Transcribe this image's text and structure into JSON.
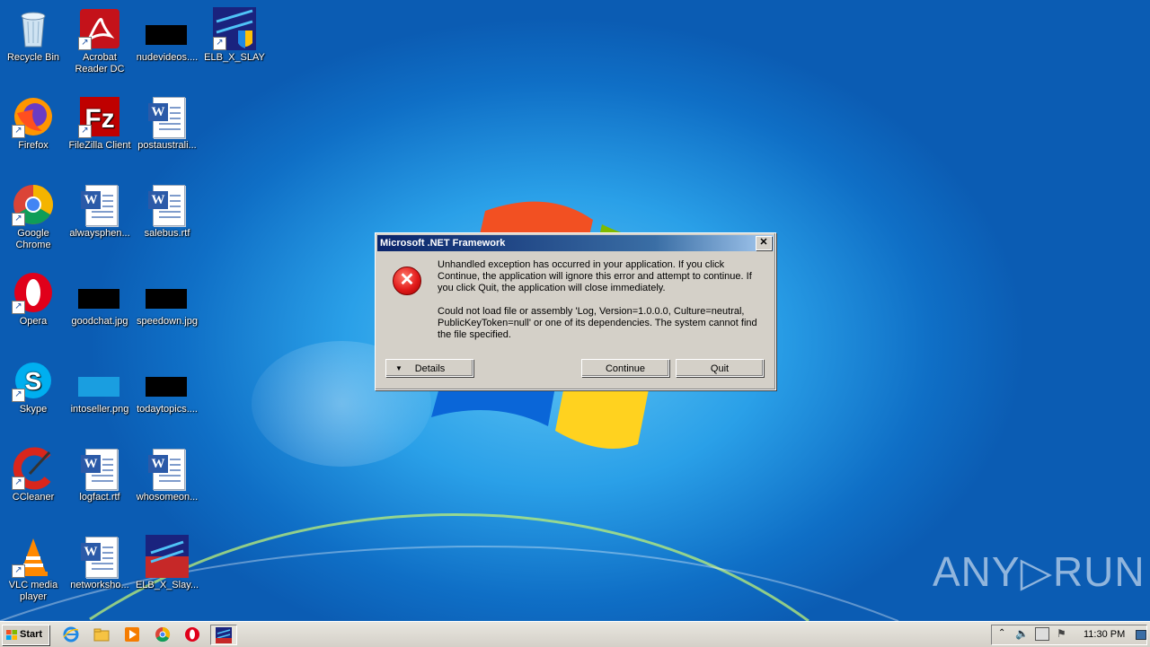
{
  "desktop": {
    "icons": [
      {
        "label": "Recycle Bin"
      },
      {
        "label": "Acrobat Reader DC"
      },
      {
        "label": "nudevideos...."
      },
      {
        "label": "ELB_X_SLAY"
      },
      {
        "label": "Firefox"
      },
      {
        "label": "FileZilla Client"
      },
      {
        "label": "postaustrali..."
      },
      {
        "label": "Google Chrome"
      },
      {
        "label": "alwaysphen..."
      },
      {
        "label": "salebus.rtf"
      },
      {
        "label": "Opera"
      },
      {
        "label": "goodchat.jpg"
      },
      {
        "label": "speedown.jpg"
      },
      {
        "label": "Skype"
      },
      {
        "label": "intoseller.png"
      },
      {
        "label": "todaytopics...."
      },
      {
        "label": "CCleaner"
      },
      {
        "label": "logfact.rtf"
      },
      {
        "label": "whosomeon..."
      },
      {
        "label": "VLC media player"
      },
      {
        "label": "networksho..."
      },
      {
        "label": "ELB_X_Slay..."
      }
    ]
  },
  "dialog": {
    "title": "Microsoft .NET Framework",
    "close_symbol": "✕",
    "message1": "Unhandled exception has occurred in your application. If you click Continue, the application will ignore this error and attempt to continue. If you click Quit, the application will close immediately.",
    "message2": "Could not load file or assembly 'Log, Version=1.0.0.0, Culture=neutral, PublicKeyToken=null' or one of its dependencies. The system cannot find the file specified.",
    "details_label": "Details",
    "continue_label": "Continue",
    "quit_label": "Quit"
  },
  "taskbar": {
    "start_label": "Start",
    "clock": "11:30 PM"
  },
  "watermark": "ANY▷RUN",
  "colors": {
    "title_bar": "#0a246a",
    "error_red": "#e21b1b",
    "dialog_bg": "#d4d0c8"
  }
}
